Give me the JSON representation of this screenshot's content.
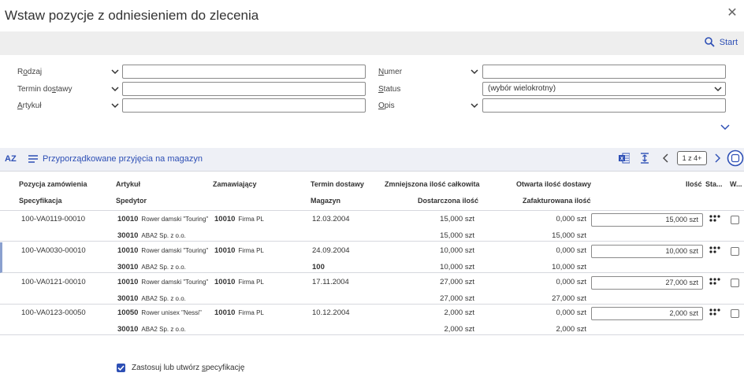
{
  "dialog": {
    "title": "Wstaw pozycje z odniesieniem do zlecenia",
    "close_icon": "close-icon",
    "start_label": "Start"
  },
  "filters": {
    "left": [
      {
        "label_pre": "R",
        "label_u": "o",
        "label_post": "dzaj",
        "value": ""
      },
      {
        "label_pre": "Termin do",
        "label_u": "s",
        "label_post": "tawy",
        "value": ""
      },
      {
        "label_pre": "",
        "label_u": "A",
        "label_post": "rtykuł",
        "value": ""
      }
    ],
    "right": [
      {
        "label_pre": "",
        "label_u": "N",
        "label_post": "umer",
        "value": ""
      },
      {
        "label_pre": "",
        "label_u": "S",
        "label_post": "tatus",
        "value": "(wybór wielokrotny)"
      },
      {
        "label_pre": "",
        "label_u": "O",
        "label_post": "pis",
        "value": ""
      }
    ]
  },
  "table": {
    "sort_label": "AZ",
    "title": "Przyporządkowane przyjęcia na magazyn",
    "pagination": "1 z 4+",
    "headers_row1": {
      "position": "Pozycja zamówienia",
      "article": "Artykuł",
      "customer": "Zamawiający",
      "delivery_date": "Termin dostawy",
      "reduced_qty": "Zmniejszona ilość całkowita",
      "open_qty": "Otwarta ilość dostawy",
      "qty": "Ilość",
      "status": "Sta...",
      "w": "W..."
    },
    "headers_row2": {
      "spec": "Specyfikacja",
      "forwarder": "Spedytor",
      "warehouse": "Magazyn",
      "delivered_qty": "Dostarczona ilość",
      "invoiced_qty": "Zafakturowana ilość"
    },
    "rows": [
      {
        "position": "100-VA0119-00010",
        "article_code": "10010",
        "article_name": "Rower damski \"Touring\"",
        "customer_code": "10010",
        "customer_name": "Firma PL",
        "delivery_date": "12.03.2004",
        "reduced_qty": "15,000 szt",
        "open_qty": "0,000 szt",
        "qty": "15,000 szt",
        "forwarder_code": "30010",
        "forwarder_name": "ABA2 Sp. z o.o.",
        "warehouse": "",
        "delivered_qty": "15,000 szt",
        "invoiced_qty": "15,000 szt"
      },
      {
        "position": "100-VA0030-00010",
        "article_code": "10010",
        "article_name": "Rower damski \"Touring\"",
        "customer_code": "10010",
        "customer_name": "Firma PL",
        "delivery_date": "24.09.2004",
        "reduced_qty": "10,000 szt",
        "open_qty": "0,000 szt",
        "qty": "10,000 szt",
        "forwarder_code": "30010",
        "forwarder_name": "ABA2 Sp. z o.o.",
        "warehouse": "100",
        "delivered_qty": "10,000 szt",
        "invoiced_qty": "10,000 szt"
      },
      {
        "position": "100-VA0121-00010",
        "article_code": "10010",
        "article_name": "Rower damski \"Touring\"",
        "customer_code": "10010",
        "customer_name": "Firma PL",
        "delivery_date": "17.11.2004",
        "reduced_qty": "27,000 szt",
        "open_qty": "0,000 szt",
        "qty": "27,000 szt",
        "forwarder_code": "30010",
        "forwarder_name": "ABA2 Sp. z o.o.",
        "warehouse": "",
        "delivered_qty": "27,000 szt",
        "invoiced_qty": "27,000 szt"
      },
      {
        "position": "100-VA0123-00050",
        "article_code": "10050",
        "article_name": "Rower unisex \"Nessi\"",
        "customer_code": "10010",
        "customer_name": "Firma PL",
        "delivery_date": "10.12.2004",
        "reduced_qty": "2,000 szt",
        "open_qty": "0,000 szt",
        "qty": "2,000 szt",
        "forwarder_code": "30010",
        "forwarder_name": "ABA2 Sp. z o.o.",
        "warehouse": "",
        "delivered_qty": "2,000 szt",
        "invoiced_qty": "2,000 szt"
      }
    ]
  },
  "footer": {
    "checkbox_pre": "Zastosuj lub utwórz ",
    "checkbox_u": "s",
    "checkbox_post": "pecyfikację",
    "checked": true
  },
  "colors": {
    "accent": "#2d4fb5",
    "row_accent": "#8aa0cf"
  }
}
